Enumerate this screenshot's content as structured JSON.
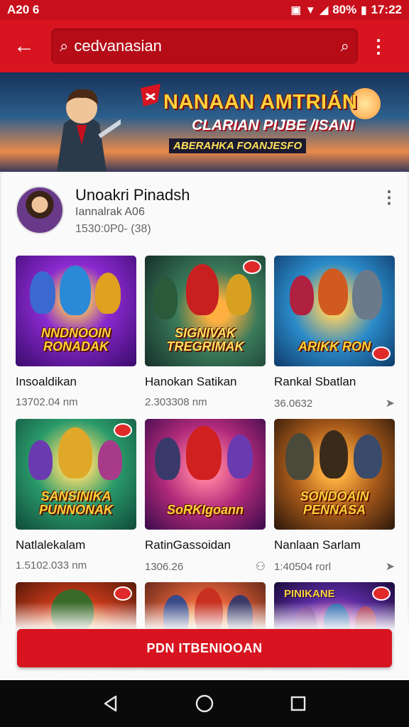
{
  "status_bar": {
    "left_text": "A20 6",
    "battery": "80%",
    "time": "17:22"
  },
  "app_bar": {
    "search_text": "cedvanasian"
  },
  "banner": {
    "line1": "NANAAN AMTRIÁN",
    "line2": "CLARIAN PIJBE /ISANI",
    "line3": "ABERAHKA FOANJESFO"
  },
  "creator": {
    "name": "Unoakri Pinadsh",
    "sub1": "Iannalrak A06",
    "sub2": "1530:0P0- (38)"
  },
  "tiles": [
    {
      "art": "NNDNOOIN RONADAK",
      "title": "Insoaldikan",
      "meta": "13702.04 nm",
      "icon": ""
    },
    {
      "art": "SIGNIVAK TREGRIMAK",
      "title": "Hanokan Satikan",
      "meta": "2.303308 nm",
      "icon": ""
    },
    {
      "art": "ARIKK RON",
      "title": "Rankal Sbatlan",
      "meta": "36.0632",
      "icon": "share-icon"
    },
    {
      "art": "SANSINIKA PUNNONAK",
      "title": "Natlalekalam",
      "meta": "1.5102.033 nm",
      "icon": ""
    },
    {
      "art": "SoRKIgoann",
      "title": "RatinGassoidan",
      "meta": "1306.26",
      "icon": "link-icon"
    },
    {
      "art": "SONDOAIN PENNASA",
      "title": "Nanlaan Sarlam",
      "meta": "1:40504 rorl",
      "icon": "share-icon"
    },
    {
      "art": "",
      "title": "",
      "meta": "",
      "icon": ""
    },
    {
      "art": "",
      "title": "",
      "meta": "",
      "icon": ""
    },
    {
      "art": "PINIKANE",
      "title": "",
      "meta": "",
      "icon": ""
    }
  ],
  "cta_label": "PDN ITBENIOOAN",
  "colors": {
    "brand_red": "#d7141f",
    "status_red": "#c8101c"
  }
}
